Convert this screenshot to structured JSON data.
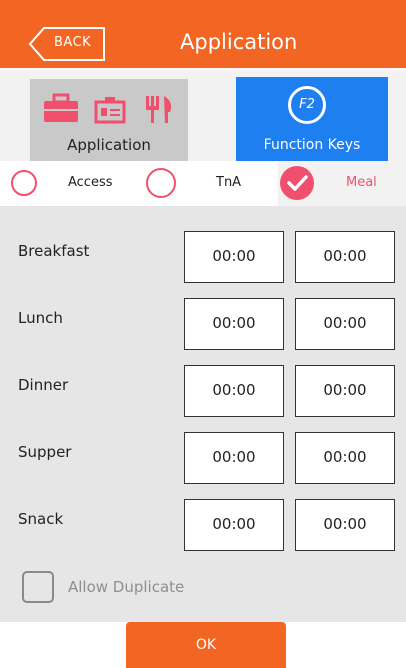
{
  "header": {
    "back_label": "BACK",
    "title": "Application"
  },
  "tiles": {
    "application": {
      "label": "Application",
      "icons": [
        "briefcase-icon",
        "id-card-icon",
        "fork-knife-icon"
      ]
    },
    "function_keys": {
      "label": "Function Keys",
      "badge": "F2"
    }
  },
  "radios": [
    {
      "label": "Access",
      "selected": false
    },
    {
      "label": "TnA",
      "selected": false
    },
    {
      "label": "Meal",
      "selected": true
    }
  ],
  "meals": [
    {
      "name": "Breakfast",
      "start": "00:00",
      "end": "00:00"
    },
    {
      "name": "Lunch",
      "start": "00:00",
      "end": "00:00"
    },
    {
      "name": "Dinner",
      "start": "00:00",
      "end": "00:00"
    },
    {
      "name": "Supper",
      "start": "00:00",
      "end": "00:00"
    },
    {
      "name": "Snack",
      "start": "00:00",
      "end": "00:00"
    }
  ],
  "allow_duplicate": {
    "label": "Allow Duplicate",
    "checked": false
  },
  "footer": {
    "ok_label": "OK"
  },
  "colors": {
    "accent": "#f26522",
    "selected": "#f0506e",
    "tile_active": "#1e7ff0"
  }
}
